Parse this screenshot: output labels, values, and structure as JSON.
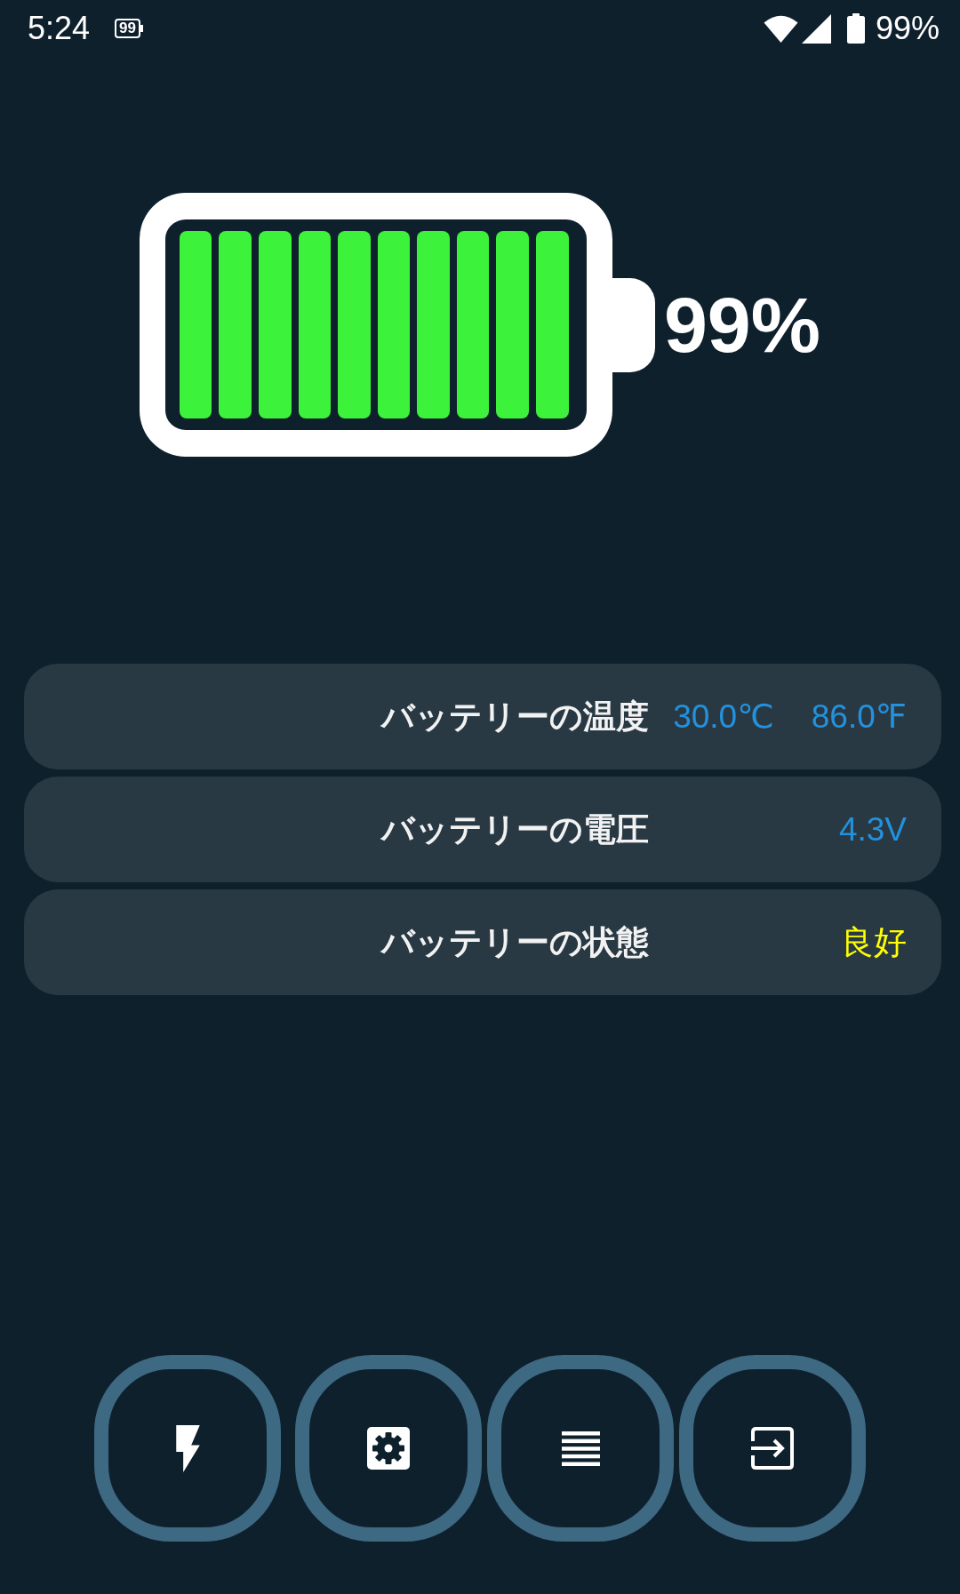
{
  "status_bar": {
    "time": "5:24",
    "battery_badge": "99",
    "battery_percent": "99%"
  },
  "battery": {
    "level": 0.99,
    "percent": "99%"
  },
  "info_rows": [
    {
      "label": "バッテリーの温度",
      "values": [
        {
          "text": "30.0℃",
          "color": "#2391dc"
        },
        {
          "text": "86.0℉",
          "color": "#2391dc"
        }
      ]
    },
    {
      "label": "バッテリーの電圧",
      "values": [
        {
          "text": "4.3V",
          "color": "#2391dc"
        }
      ]
    },
    {
      "label": "バッテリーの状態",
      "values": [
        {
          "text": "良好",
          "color": "#ffff00"
        }
      ]
    }
  ]
}
